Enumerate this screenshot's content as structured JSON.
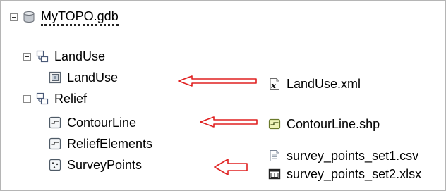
{
  "tree": {
    "root": {
      "label": "MyTOPO.gdb",
      "icon": "geodatabase-icon"
    },
    "datasets": [
      {
        "label": "LandUse",
        "icon": "feature-dataset-icon",
        "children": [
          {
            "label": "LandUse",
            "icon": "polygon-feature-class-icon"
          }
        ]
      },
      {
        "label": "Relief",
        "icon": "feature-dataset-icon",
        "children": [
          {
            "label": "ContourLine",
            "icon": "line-feature-class-icon"
          },
          {
            "label": "ReliefElements",
            "icon": "line-feature-class-icon"
          },
          {
            "label": "SurveyPoints",
            "icon": "point-feature-class-icon"
          }
        ]
      }
    ]
  },
  "source_files": [
    {
      "label": "LandUse.xml",
      "icon": "xml-file-icon"
    },
    {
      "label": "ContourLine.shp",
      "icon": "shapefile-icon"
    },
    {
      "label": "survey_points_set1.csv",
      "icon": "csv-file-icon"
    },
    {
      "label": "survey_points_set2.xlsx",
      "icon": "excel-file-icon"
    }
  ],
  "colors": {
    "arrow": "#e02020",
    "frame_border": "#b5b5b5"
  }
}
